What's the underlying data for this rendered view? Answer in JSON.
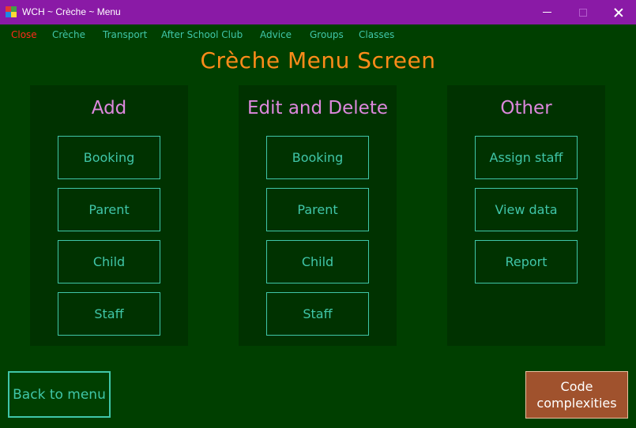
{
  "window": {
    "title": "WCH ~ Crèche ~ Menu",
    "titlebar_color": "#8a1aa6"
  },
  "menu": {
    "items": [
      "Close",
      "Crèche",
      "Transport",
      "After School Club",
      "Advice",
      "Groups",
      "Classes"
    ],
    "colors": {
      "close": "#ff2a1a",
      "default": "#40c6a8"
    }
  },
  "screen_title": "Crèche Menu Screen",
  "panels": {
    "add": {
      "heading": "Add",
      "buttons": [
        "Booking",
        "Parent",
        "Child",
        "Staff"
      ]
    },
    "edit_delete": {
      "heading": "Edit and Delete",
      "buttons": [
        "Booking",
        "Parent",
        "Child",
        "Staff"
      ]
    },
    "other": {
      "heading": "Other",
      "buttons": [
        "Assign staff",
        "View data",
        "Report"
      ]
    }
  },
  "footer": {
    "back_label": "Back to menu",
    "code_line1": "Code",
    "code_line2": "complexities"
  },
  "colors": {
    "background": "#003f00",
    "panel": "#003200",
    "accent": "#40c6a8",
    "heading": "#dd88dd",
    "title": "#ff8c1a",
    "code_button": "#a0522d"
  },
  "icons": {
    "app": "app-icon",
    "minimize": "minimize-icon",
    "maximize": "maximize-icon",
    "close": "close-icon"
  }
}
